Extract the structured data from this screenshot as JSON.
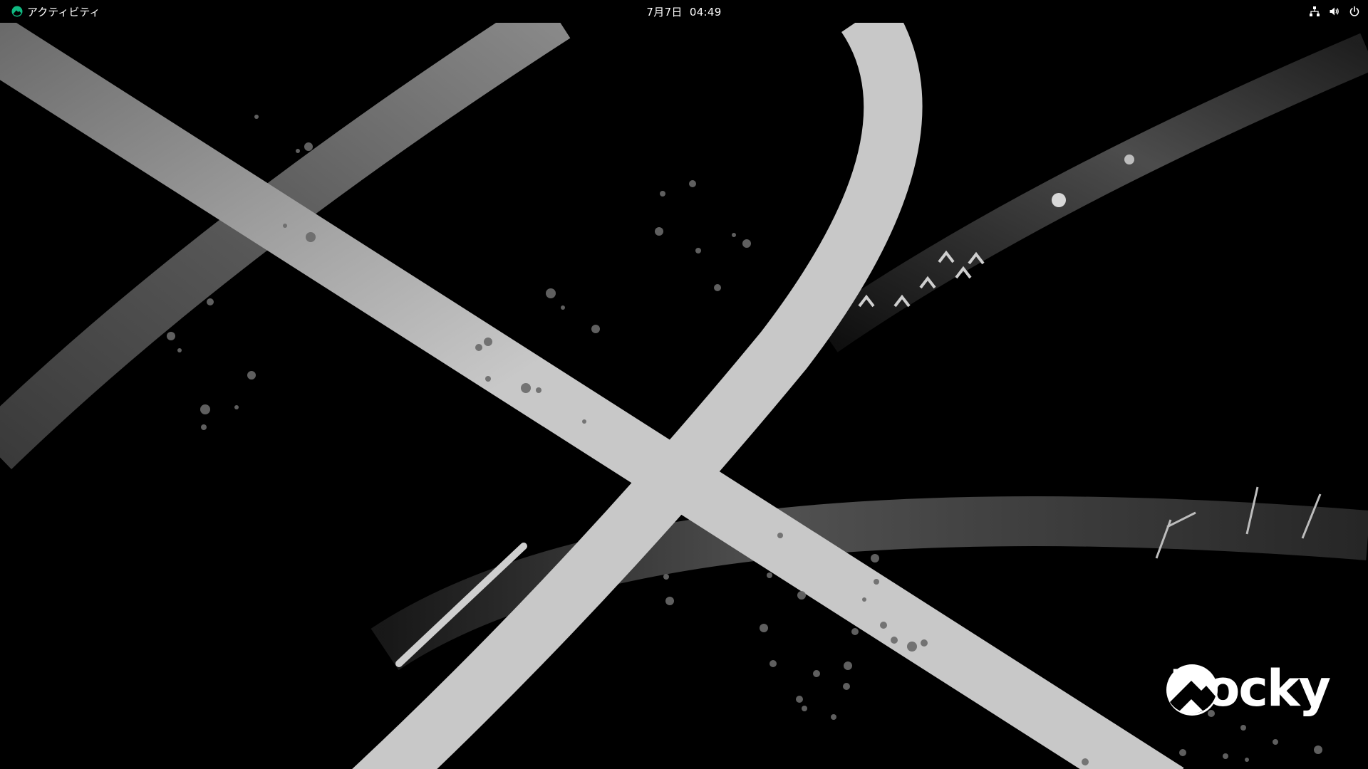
{
  "topbar": {
    "activities_label": "アクティビティ",
    "activities_icon": "rocky-logo-icon",
    "clock": "7月7日  04:49",
    "system_icons": [
      "network-wired-icon",
      "volume-icon",
      "power-icon"
    ]
  },
  "desktop": {
    "wallpaper": "rocky-linux-abstract-wallpaper",
    "brand_label": "Rocky",
    "brand_icon": "rocky-mountain-logo-icon"
  },
  "colors": {
    "topbar_bg": "#000000",
    "topbar_text": "#ffffff",
    "accent": "#10b981",
    "wallpaper_bg": "#000000",
    "stroke_light": "#c8c8c8"
  }
}
